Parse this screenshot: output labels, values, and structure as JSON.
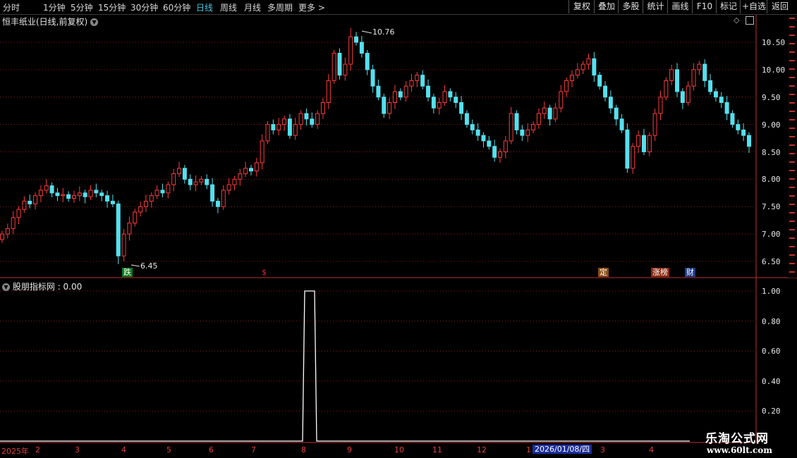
{
  "periods": [
    "分时",
    "1分钟",
    "5分钟",
    "15分钟",
    "30分钟",
    "60分钟",
    "日线",
    "周线",
    "月线",
    "多周期",
    "更多 >"
  ],
  "active_period": "日线",
  "toolbar_buttons": [
    "复权",
    "叠加",
    "多股",
    "统计",
    "画线",
    "F10",
    "标记",
    "+自选",
    "返回"
  ],
  "stock_title": "恒丰纸业(日线,前复权)",
  "indicator_title": "股朋指标网 : 0.00",
  "price_axis": [
    "10.50",
    "10.00",
    "9.50",
    "9.00",
    "8.50",
    "8.00",
    "7.50",
    "7.00",
    "6.50"
  ],
  "ind_axis": [
    "1.00",
    "0.80",
    "0.60",
    "0.40",
    "0.20"
  ],
  "high_label": "10.76",
  "low_label": "6.45",
  "event_marks": [
    {
      "text": "跌",
      "bg": "#0b7a1b",
      "fg": "#ffffff"
    },
    {
      "text": "$",
      "bg": "#000000",
      "fg": "#e03030"
    },
    {
      "text": "定",
      "bg": "#8a4b12",
      "fg": "#ffffff"
    },
    {
      "text": "涨榜",
      "bg": "#8a2a12",
      "fg": "#ffffff"
    },
    {
      "text": "财",
      "bg": "#1e3a8a",
      "fg": "#ffffff"
    }
  ],
  "x_axis_labels": [
    "2025年",
    "2",
    "3",
    "4",
    "5",
    "6",
    "7",
    "8",
    "9",
    "10",
    "11",
    "12",
    "1",
    "3",
    "4"
  ],
  "selected_date": "2026/01/08/四",
  "watermark": {
    "line1": "乐淘公式网",
    "line2": "www.60lt.com"
  },
  "colors": {
    "up": "#ff3c3c",
    "down": "#54e0ee",
    "grid": "#8b1a1a",
    "axis": "#c03030",
    "active": "#45c8e0"
  },
  "chart_data": [
    {
      "type": "candlestick",
      "ylim": [
        6.3,
        10.9
      ],
      "close_series": [
        7.0,
        7.1,
        7.3,
        7.45,
        7.6,
        7.55,
        7.7,
        7.8,
        7.88,
        7.75,
        7.7,
        7.72,
        7.65,
        7.7,
        7.75,
        7.68,
        7.8,
        7.75,
        7.7,
        7.6,
        7.55,
        6.6,
        7.0,
        7.2,
        7.4,
        7.5,
        7.6,
        7.7,
        7.8,
        7.75,
        7.9,
        8.1,
        8.2,
        8.0,
        7.9,
        7.95,
        8.0,
        7.9,
        7.6,
        7.5,
        7.8,
        7.9,
        8.0,
        8.1,
        8.2,
        8.15,
        8.3,
        8.7,
        9.0,
        8.9,
        9.0,
        9.1,
        8.8,
        9.0,
        9.2,
        9.1,
        9.0,
        9.2,
        9.4,
        9.8,
        10.3,
        9.9,
        10.1,
        10.6,
        10.5,
        10.3,
        10.0,
        9.7,
        9.5,
        9.2,
        9.4,
        9.6,
        9.5,
        9.7,
        9.8,
        9.9,
        9.7,
        9.5,
        9.3,
        9.4,
        9.6,
        9.5,
        9.4,
        9.2,
        9.0,
        8.9,
        8.8,
        8.7,
        8.6,
        8.4,
        8.5,
        8.7,
        9.2,
        8.9,
        8.8,
        8.9,
        9.0,
        9.2,
        9.3,
        9.1,
        9.3,
        9.6,
        9.8,
        9.9,
        10.0,
        10.1,
        10.2,
        9.9,
        9.7,
        9.5,
        9.3,
        9.1,
        8.9,
        8.2,
        8.6,
        8.8,
        8.5,
        8.8,
        9.2,
        9.5,
        9.8,
        10.0,
        9.6,
        9.4,
        9.7,
        10.0,
        10.1,
        9.8,
        9.6,
        9.5,
        9.4,
        9.2,
        9.0,
        8.9,
        8.8,
        8.6
      ],
      "high": 10.76,
      "low": 6.45
    },
    {
      "type": "line",
      "ylim": [
        0,
        1.1
      ],
      "x": [
        "2025-08-04",
        "2025-08-05",
        "2025-08-06",
        "2025-08-07",
        "2025-08-08",
        "2025-08-11"
      ],
      "values": [
        0,
        1.0,
        1.0,
        1.0,
        1.0,
        0
      ]
    }
  ]
}
